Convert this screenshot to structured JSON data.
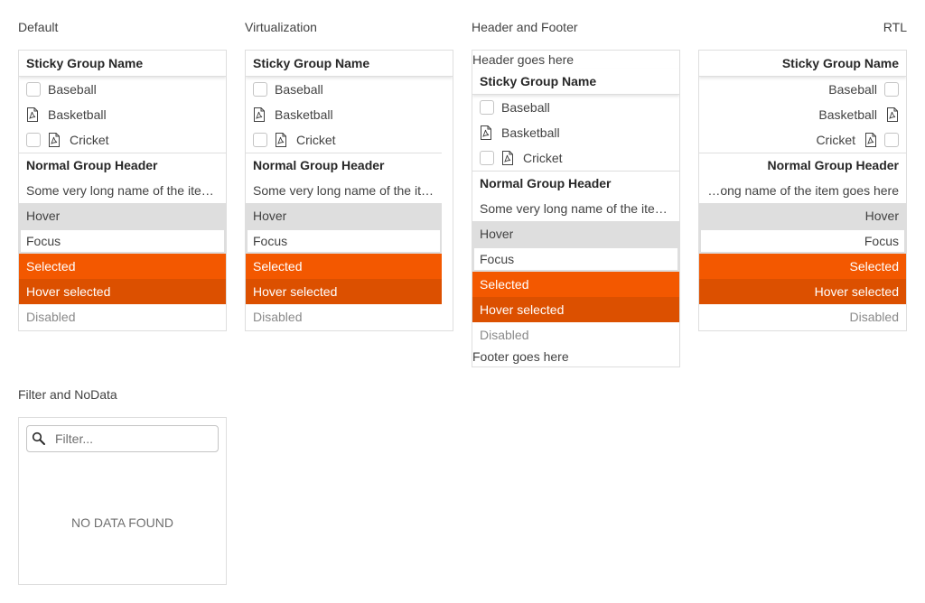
{
  "demos": {
    "default": {
      "title": "Default"
    },
    "virtualization": {
      "title": "Virtualization"
    },
    "header_footer": {
      "title": "Header and Footer",
      "header_text": "Header goes here",
      "footer_text": "Footer goes here"
    },
    "rtl": {
      "title": "RTL"
    },
    "filter": {
      "title": "Filter and NoData",
      "placeholder": "Filter...",
      "no_data": "NO DATA FOUND"
    }
  },
  "list": {
    "sticky_group": "Sticky Group Name",
    "items": [
      "Baseball",
      "Basketball",
      "Cricket"
    ],
    "normal_group": "Normal Group Header",
    "long_item": "Some very long name of the item goes here",
    "long_item_rtl_display": "…ong name of the item goes here",
    "hover": "Hover",
    "focus": "Focus",
    "selected": "Selected",
    "hover_selected": "Hover selected",
    "disabled": "Disabled"
  },
  "colors": {
    "selected": "#f35800",
    "hover_selected": "#dc5000",
    "hover": "#dedede",
    "border": "#dedede"
  },
  "icons": {
    "checkbox": "checkbox-icon",
    "pdf": "pdf-file-icon",
    "search": "search-icon"
  }
}
